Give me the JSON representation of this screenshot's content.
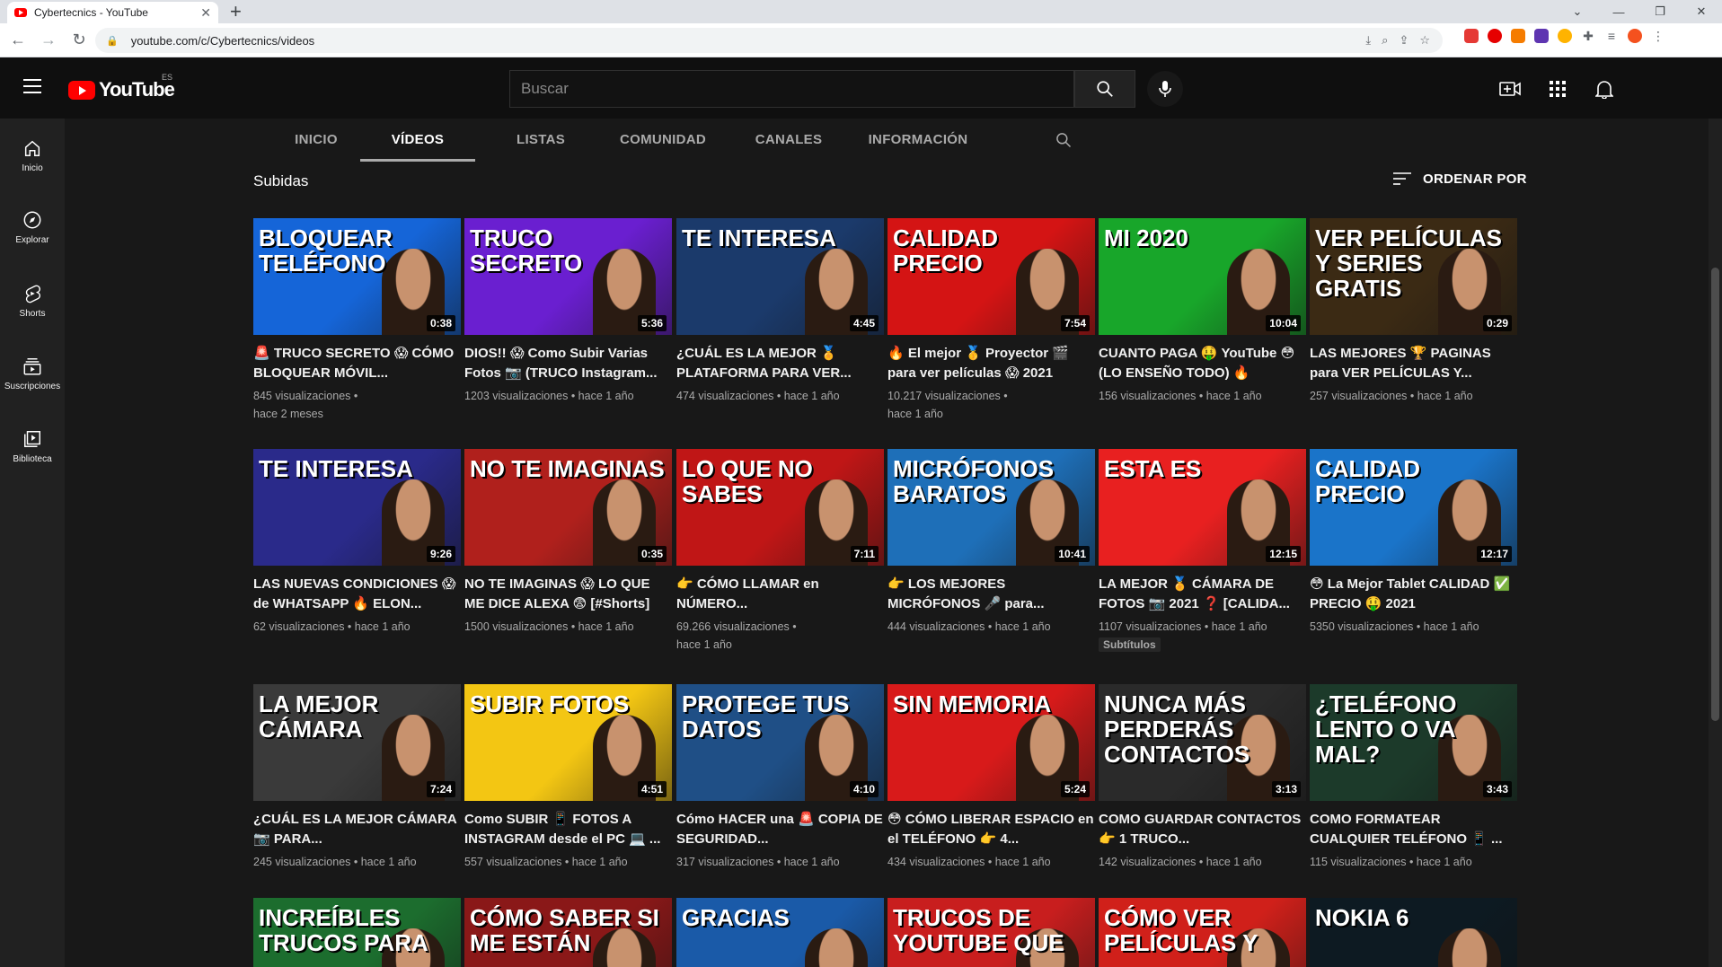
{
  "browser": {
    "tab_title": "Cybertecnics - YouTube",
    "url": "youtube.com/c/Cybertecnics/videos"
  },
  "masthead": {
    "logo_text": "YouTube",
    "country_code": "ES",
    "search_placeholder": "Buscar"
  },
  "sidebar": {
    "items": [
      {
        "label": "Inicio",
        "icon": "home-icon"
      },
      {
        "label": "Explorar",
        "icon": "compass-icon"
      },
      {
        "label": "Shorts",
        "icon": "shorts-icon"
      },
      {
        "label": "Suscripciones",
        "icon": "subscriptions-icon"
      },
      {
        "label": "Biblioteca",
        "icon": "library-icon"
      }
    ]
  },
  "channel_tabs": [
    "INICIO",
    "VÍDEOS",
    "LISTAS",
    "COMUNIDAD",
    "CANALES",
    "INFORMACIÓN"
  ],
  "active_tab": "VÍDEOS",
  "section": {
    "title": "Subidas",
    "sort_label": "ORDENAR POR"
  },
  "videos": [
    {
      "thumb_text": "BLOQUEAR TELÉFONO",
      "bg": "#1565d8",
      "duration": "0:38",
      "title": "🚨 TRUCO SECRETO 😱 CÓMO BLOQUEAR MÓVIL...",
      "views": "845 visualizaciones •",
      "age": "hace 2 meses"
    },
    {
      "thumb_text": "TRUCO SECRETO",
      "bg": "#6a1fd0",
      "duration": "5:36",
      "title": "DIOS!! 😱 Como Subir Varias Fotos 📷 (TRUCO Instagram...",
      "views": "1203 visualizaciones • hace 1 año",
      "age": ""
    },
    {
      "thumb_text": "TE INTERESA",
      "bg": "#1b3a6b",
      "duration": "4:45",
      "title": "¿CUÁL ES LA MEJOR 🏅 PLATAFORMA PARA VER...",
      "views": "474 visualizaciones • hace 1 año",
      "age": ""
    },
    {
      "thumb_text": "CALIDAD PRECIO",
      "bg": "#d41414",
      "duration": "7:54",
      "title": "🔥 El mejor 🥇 Proyector 🎬 para ver películas 😱 2021",
      "views": "10.217 visualizaciones •",
      "age": "hace 1 año"
    },
    {
      "thumb_text": "MI 2020",
      "bg": "#18a62a",
      "duration": "10:04",
      "title": "CUANTO PAGA 🤑 YouTube 😳 (LO ENSEÑO TODO) 🔥",
      "views": "156 visualizaciones • hace 1 año",
      "age": ""
    },
    {
      "thumb_text": "VER PELÍCULAS Y SERIES GRATIS",
      "bg": "#3b2a14",
      "duration": "0:29",
      "title": "LAS MEJORES 🏆 PAGINAS para VER PELÍCULAS Y...",
      "views": "257 visualizaciones • hace 1 año",
      "age": ""
    },
    {
      "thumb_text": "TE INTERESA",
      "bg": "#2a2a8a",
      "duration": "9:26",
      "title": "LAS NUEVAS CONDICIONES 😱 de WHATSAPP 🔥 ELON...",
      "views": "62 visualizaciones • hace 1 año",
      "age": ""
    },
    {
      "thumb_text": "NO TE IMAGINAS",
      "bg": "#b0201c",
      "duration": "0:35",
      "title": "NO TE IMAGINAS 😱 LO QUE ME DICE ALEXA 😨 [#Shorts]",
      "views": "1500 visualizaciones • hace 1 año",
      "age": ""
    },
    {
      "thumb_text": "LO QUE NO SABES",
      "bg": "#c01616",
      "duration": "7:11",
      "title": "👉 CÓMO LLAMAR en NÚMERO...",
      "views": "69.266 visualizaciones •",
      "age": "hace 1 año"
    },
    {
      "thumb_text": "MICRÓFONOS BARATOS",
      "bg": "#1e6fb8",
      "duration": "10:41",
      "title": "👉 LOS MEJORES MICRÓFONOS 🎤 para...",
      "views": "444 visualizaciones • hace 1 año",
      "age": ""
    },
    {
      "thumb_text": "ESTA ES",
      "bg": "#e82020",
      "duration": "12:15",
      "title": "LA MEJOR 🏅 CÁMARA DE FOTOS 📷 2021 ❓ [CALIDA...",
      "views": "1107 visualizaciones • hace 1 año",
      "age": "",
      "badge": "Subtítulos"
    },
    {
      "thumb_text": "CALIDAD PRECIO",
      "bg": "#1a74c9",
      "duration": "12:17",
      "title": "😳 La Mejor Tablet CALIDAD ✅ PRECIO 🤑 2021",
      "views": "5350 visualizaciones • hace 1 año",
      "age": ""
    },
    {
      "thumb_text": "LA MEJOR CÁMARA",
      "bg": "#3a3a3a",
      "duration": "7:24",
      "title": "¿CUÁL ES LA MEJOR CÁMARA 📷 PARA...",
      "views": "245 visualizaciones • hace 1 año",
      "age": ""
    },
    {
      "thumb_text": "SUBIR FOTOS",
      "bg": "#f3c613",
      "duration": "4:51",
      "title": "Como SUBIR 📱 FOTOS A INSTAGRAM desde el PC 💻 ...",
      "views": "557 visualizaciones • hace 1 año",
      "age": ""
    },
    {
      "thumb_text": "PROTEGE TUS DATOS",
      "bg": "#1f4f86",
      "duration": "4:10",
      "title": "Cómo HACER una 🚨 COPIA DE SEGURIDAD...",
      "views": "317 visualizaciones • hace 1 año",
      "age": ""
    },
    {
      "thumb_text": "SIN MEMORIA",
      "bg": "#d81a1a",
      "duration": "5:24",
      "title": "😳 CÓMO LIBERAR ESPACIO en el TELÉFONO 👉 4...",
      "views": "434 visualizaciones • hace 1 año",
      "age": ""
    },
    {
      "thumb_text": "NUNCA MÁS PERDERÁS CONTACTOS",
      "bg": "#2a2a2a",
      "duration": "3:13",
      "title": "COMO GUARDAR CONTACTOS 👉 1 TRUCO...",
      "views": "142 visualizaciones • hace 1 año",
      "age": ""
    },
    {
      "thumb_text": "¿TELÉFONO LENTO O VA MAL?",
      "bg": "#1c3a2a",
      "duration": "3:43",
      "title": "COMO FORMATEAR CUALQUIER TELÉFONO 📱 ...",
      "views": "115 visualizaciones • hace 1 año",
      "age": ""
    },
    {
      "thumb_text": "INCREÍBLES TRUCOS PARA",
      "bg": "#1c6d2e",
      "duration": "",
      "title": "",
      "views": "",
      "age": ""
    },
    {
      "thumb_text": "CÓMO SABER SI ME ESTÁN",
      "bg": "#8a1818",
      "duration": "",
      "title": "",
      "views": "",
      "age": ""
    },
    {
      "thumb_text": "Gracias",
      "bg": "#1a5aa8",
      "duration": "",
      "title": "",
      "views": "",
      "age": ""
    },
    {
      "thumb_text": "TRUCOS DE YOUTUBE QUE",
      "bg": "#c81e1e",
      "duration": "",
      "title": "",
      "views": "",
      "age": ""
    },
    {
      "thumb_text": "CÓMO VER PELÍCULAS Y",
      "bg": "#d0201a",
      "duration": "",
      "title": "",
      "views": "",
      "age": ""
    },
    {
      "thumb_text": "NOKIA 6",
      "bg": "#0d1a22",
      "duration": "",
      "title": "",
      "views": "",
      "age": ""
    }
  ]
}
